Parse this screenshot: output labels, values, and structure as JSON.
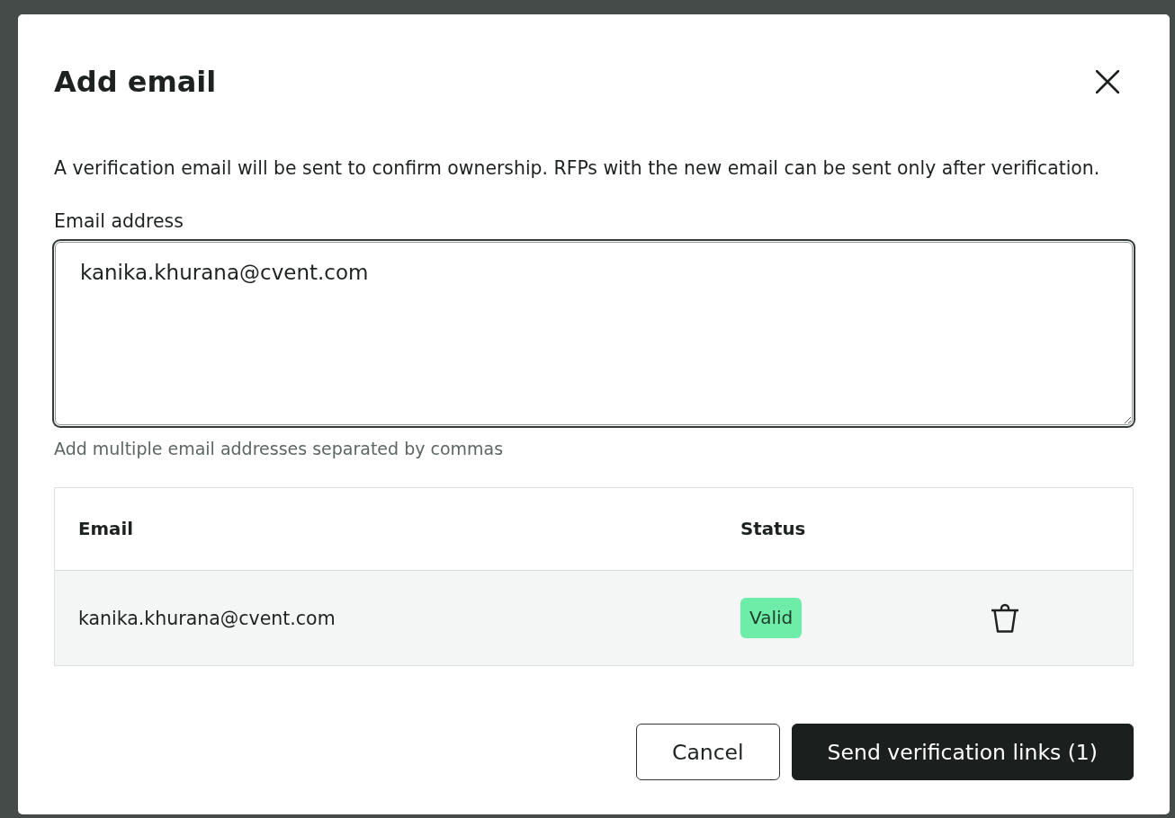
{
  "dialog": {
    "title": "Add email",
    "description": "A verification email will be sent to confirm ownership. RFPs with the new email can be sent only after verification.",
    "email_field": {
      "label": "Email address",
      "value": "kanika.khurana@cvent.com",
      "focused": true,
      "hint": "Add multiple email addresses separated by commas"
    },
    "table": {
      "columns": [
        "Email",
        "Status"
      ],
      "rows": [
        {
          "email": "kanika.khurana@cvent.com",
          "status": "Valid",
          "color": "#6eeda8"
        }
      ]
    },
    "buttons": [
      {
        "label": "Cancel",
        "kind": "secondary"
      },
      {
        "label": "Send verification links (1)",
        "kind": "primary"
      }
    ]
  }
}
